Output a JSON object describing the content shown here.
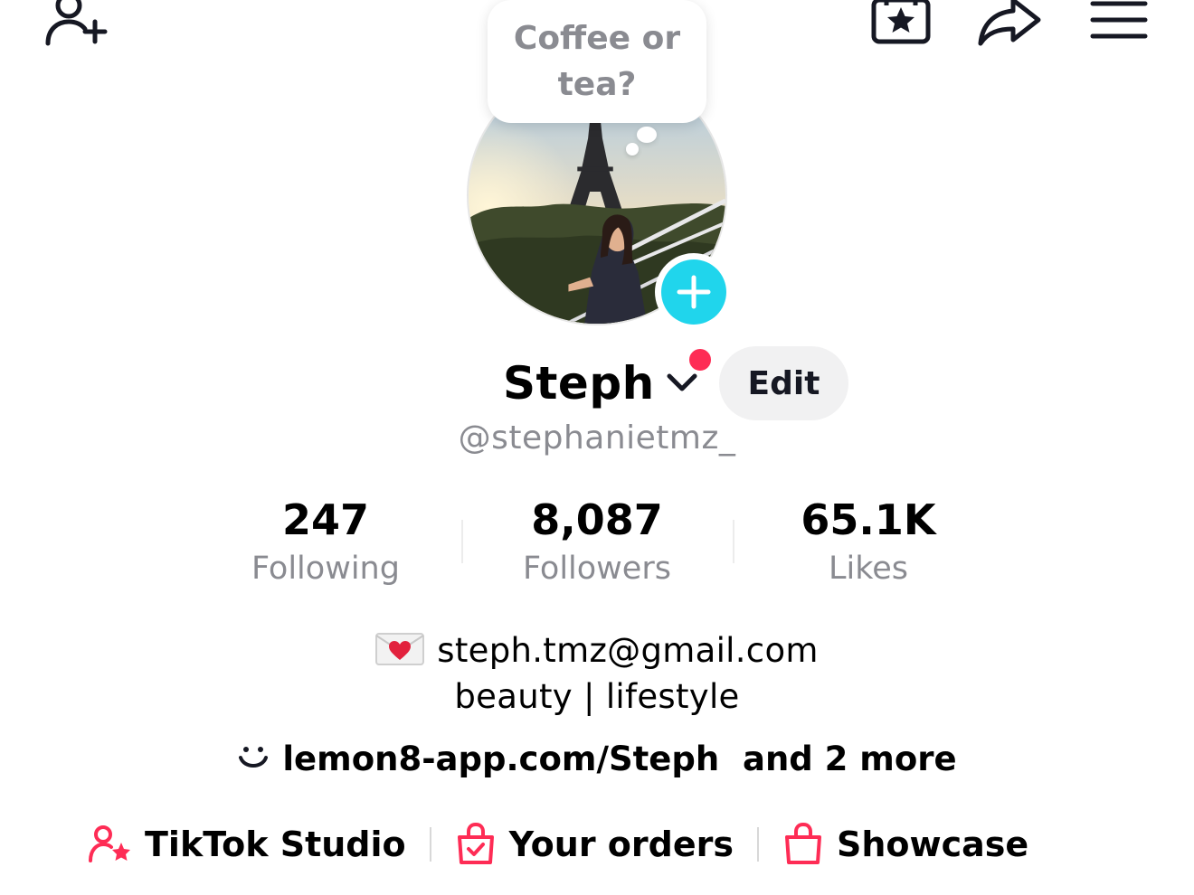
{
  "header": {
    "icons": [
      "add-friend-icon",
      "favorites-icon",
      "share-icon",
      "menu-icon"
    ]
  },
  "bubble": {
    "text": "Coffee or tea?"
  },
  "profile": {
    "name": "Steph",
    "edit_label": "Edit",
    "username": "@stephanietmz_"
  },
  "stats": [
    {
      "value": "247",
      "label": "Following"
    },
    {
      "value": "8,087",
      "label": "Followers"
    },
    {
      "value": "65.1K",
      "label": "Likes"
    }
  ],
  "bio": {
    "email": "steph.tmz@gmail.com",
    "line2": "beauty | lifestyle"
  },
  "link": {
    "url": "lemon8-app.com/Steph",
    "more": "and 2 more"
  },
  "shortcuts": [
    {
      "label": "TikTok Studio",
      "icon": "creator-star-icon"
    },
    {
      "label": "Your orders",
      "icon": "orders-bag-icon"
    },
    {
      "label": "Showcase",
      "icon": "showcase-bag-icon"
    }
  ],
  "colors": {
    "accent": "#fe2c55",
    "add_button": "#20d5ec",
    "secondary_text": "#8a8b91",
    "edit_bg": "#f1f1f2"
  }
}
